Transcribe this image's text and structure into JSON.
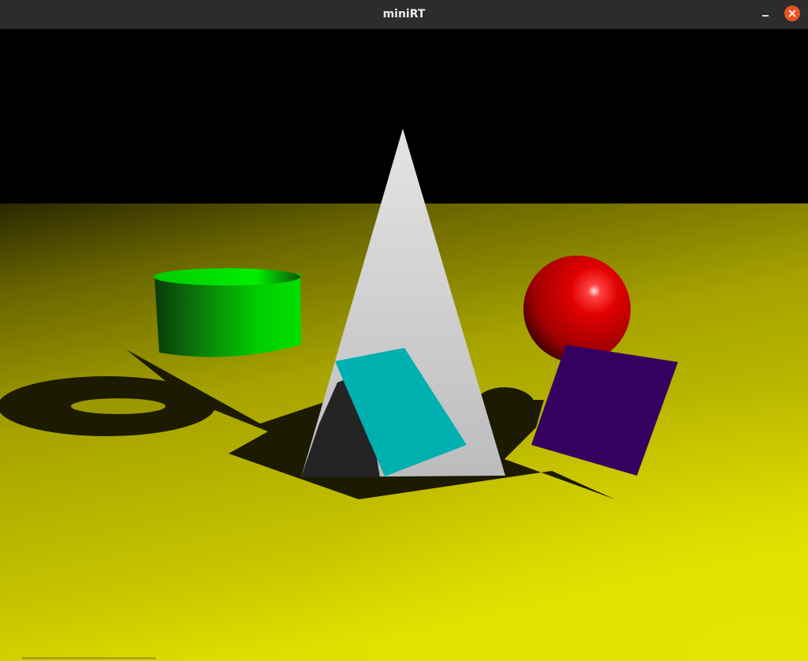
{
  "window": {
    "title": "miniRT"
  },
  "controls": {
    "minimize_icon": "minimize-icon",
    "close_icon": "close-icon"
  },
  "scene": {
    "colors": {
      "background": "#000000",
      "floor": "#c8c800",
      "cylinder": "#00e000",
      "cone": "#d0d0d0",
      "sphere": "#e00000",
      "square_cyan": "#00b0b0",
      "square_purple": "#360060",
      "shadow": "#1c1a00",
      "titlebar": "#2c2c2c",
      "close_button": "#e95420"
    }
  }
}
